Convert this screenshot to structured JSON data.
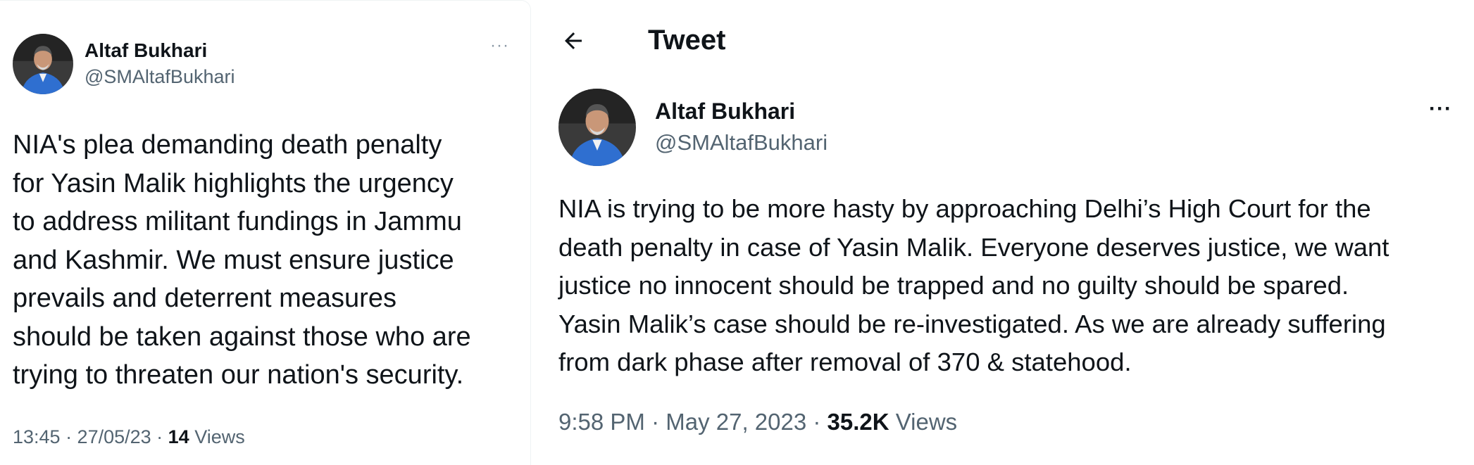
{
  "left_tweet": {
    "author_name": "Altaf Bukhari",
    "author_handle": "@SMAltafBukhari",
    "more_menu": "···",
    "text": "NIA's plea demanding death penalty\nfor Yasin Malik highlights the urgency\nto address militant fundings in Jammu\nand Kashmir. We must ensure justice\nprevails and deterrent measures\nshould be taken against those who are\ntrying to threaten our nation's security.",
    "timestamp": "13:45 · 27/05/23 · ",
    "views_count": "14",
    "views_label": " Views"
  },
  "right_tweet": {
    "header_title": "Tweet",
    "author_name": "Altaf Bukhari",
    "author_handle": "@SMAltafBukhari",
    "more_menu": "···",
    "text": "NIA is trying to be more hasty by approaching Delhi’s High Court for the\ndeath penalty in case of Yasin Malik. Everyone deserves justice, we want\njustice no innocent should be trapped and no guilty should be spared.\nYasin Malik’s case should be re-investigated. As we are already suffering\nfrom dark phase after removal of 370 & statehood.",
    "timestamp": "9:58 PM · May 27, 2023 · ",
    "views_count": "35.2K",
    "views_label": " Views"
  },
  "icons": {
    "back": "back-arrow-icon",
    "more": "more-horizontal-icon"
  },
  "colors": {
    "text_primary": "#0f1419",
    "text_secondary": "#536471",
    "avatar_jacket": "#2f6fd0",
    "border": "#eff3f4"
  }
}
